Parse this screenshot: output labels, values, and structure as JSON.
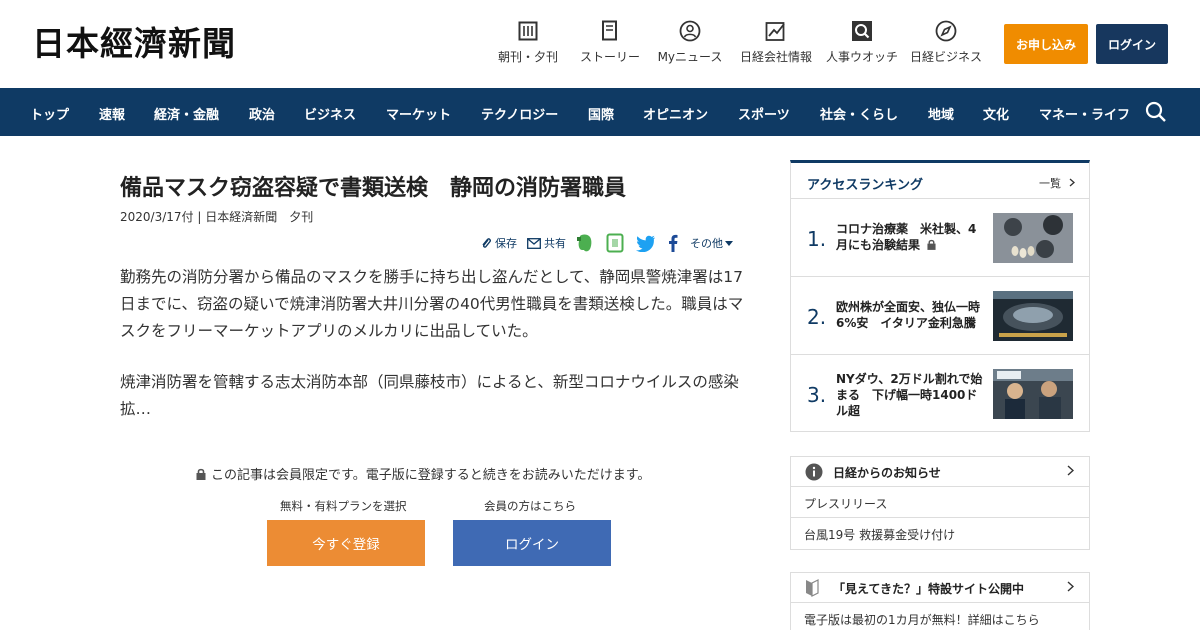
{
  "header": {
    "logo_text": "日本經濟新聞",
    "nav": [
      {
        "label": "朝刊・夕刊",
        "icon": "newspaper-icon"
      },
      {
        "label": "ストーリー",
        "icon": "document-icon"
      },
      {
        "label": "Myニュース",
        "icon": "user-icon"
      },
      {
        "label": "日経会社情報",
        "icon": "chart-icon"
      },
      {
        "label": "人事ウオッチ",
        "icon": "search-person-icon"
      },
      {
        "label": "日経ビジネス",
        "icon": "compass-icon"
      }
    ],
    "apply_label": "お申し込み",
    "login_label": "ログイン"
  },
  "navbar": {
    "items": [
      "トップ",
      "速報",
      "経済・金融",
      "政治",
      "ビジネス",
      "マーケット",
      "テクノロジー",
      "国際",
      "オピニオン",
      "スポーツ",
      "社会・くらし",
      "地域",
      "文化",
      "マネー・ライフ"
    ],
    "search_icon": "search-icon"
  },
  "article": {
    "title": "備品マスク窃盗容疑で書類送検　静岡の消防署職員",
    "meta": "2020/3/17付 | 日本経済新聞　夕刊",
    "share": {
      "save_label": "保存",
      "share_label": "共有",
      "more_label": "その他"
    },
    "paragraph1": "勤務先の消防分署から備品のマスクを勝手に持ち出し盗んだとして、静岡県警焼津署は17日までに、窃盗の疑いで焼津消防署大井川分署の40代男性職員を書類送検した。職員はマスクをフリーマーケットアプリのメルカリに出品していた。",
    "paragraph2": "焼津消防署を管轄する志太消防本部（同県藤枝市）によると、新型コロナウイルスの感染拡…",
    "paywall_note": "この記事は会員限定です。電子版に登録すると続きをお読みいただけます。",
    "plan_caption": "無料・有料プランを選択",
    "member_caption": "会員の方はこちら",
    "register_label": "今すぐ登録",
    "member_login_label": "ログイン"
  },
  "ranking": {
    "title": "アクセスランキング",
    "more_label": "一覧",
    "items": [
      {
        "num": "1.",
        "text": "コロナ治療薬　米社製、4月にも治験結果",
        "locked": true
      },
      {
        "num": "2.",
        "text": "欧州株が全面安、独仏一時6%安　イタリア金利急騰",
        "locked": false
      },
      {
        "num": "3.",
        "text": "NYダウ、2万ドル割れで始まる　下げ幅一時1400ドル超",
        "locked": false
      }
    ]
  },
  "notices": {
    "title": "日経からのお知らせ",
    "items": [
      "プレスリリース",
      "台風19号 救援募金受け付け"
    ]
  },
  "campaign": {
    "title": "「見えてきた？」特設サイト公開中",
    "items": [
      "電子版は最初の1カ月が無料！詳細はこちら"
    ]
  },
  "colors": {
    "navy": "#0f3a64",
    "orange": "#f08c00",
    "register_orange": "#ec8c34",
    "login_blue": "#3f6ab4"
  }
}
